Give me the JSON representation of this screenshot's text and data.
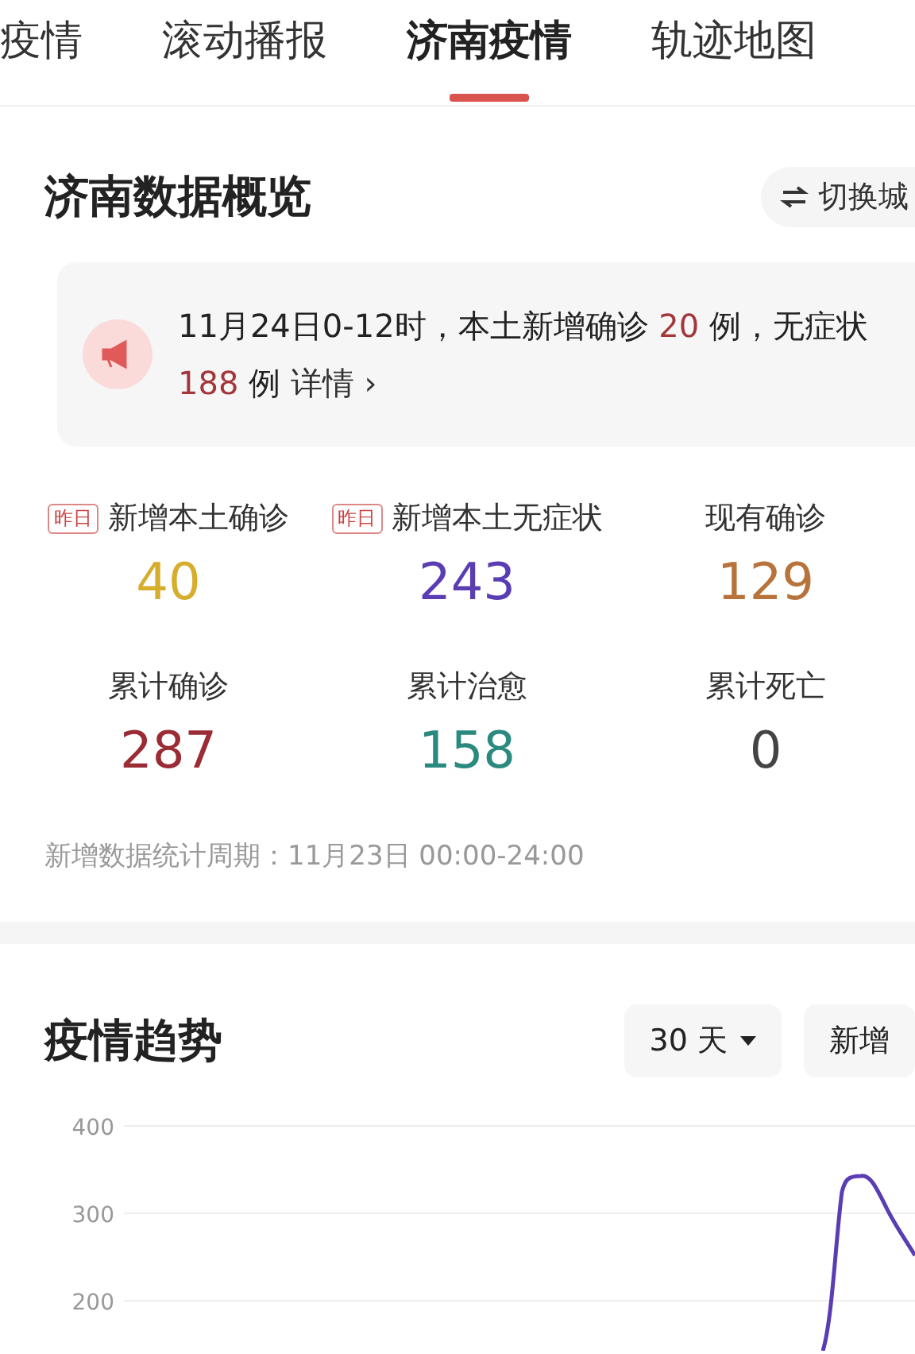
{
  "tabs": [
    {
      "label": "疫情",
      "selected": false
    },
    {
      "label": "滚动播报",
      "selected": false
    },
    {
      "label": "济南疫情",
      "selected": true
    },
    {
      "label": "轨迹地图",
      "selected": false
    }
  ],
  "overview": {
    "title": "济南数据概览",
    "switch_button": "切换城",
    "notice": {
      "segments": [
        {
          "kind": "text",
          "text": "11月24日0-12时，本土新增确诊 "
        },
        {
          "kind": "number",
          "text": "20"
        },
        {
          "kind": "text",
          "text": " 例，无症状 "
        },
        {
          "kind": "number",
          "text": "188"
        },
        {
          "kind": "text",
          "text": " 例 "
        }
      ],
      "link": "详情 ›"
    },
    "stats": [
      {
        "badge": "昨日",
        "label": "新增本土确诊",
        "value": "40",
        "color": "#d6ad2c"
      },
      {
        "badge": "昨日",
        "label": "新增本土无症状",
        "value": "243",
        "color": "#5a3db3"
      },
      {
        "label": "现有确诊",
        "value": "129",
        "color": "#b8733a"
      },
      {
        "label": "累计确诊",
        "value": "287",
        "color": "#9b2c35"
      },
      {
        "label": "累计治愈",
        "value": "158",
        "color": "#2a8a7f"
      },
      {
        "label": "累计死亡",
        "value": "0",
        "color": "#444444"
      }
    ],
    "period": "新增数据统计周期：11月23日 00:00-24:00"
  },
  "trend": {
    "title": "疫情趋势",
    "range_button": "30 天",
    "type_button": "新增",
    "y_ticks": [
      "400",
      "300",
      "200"
    ]
  }
}
